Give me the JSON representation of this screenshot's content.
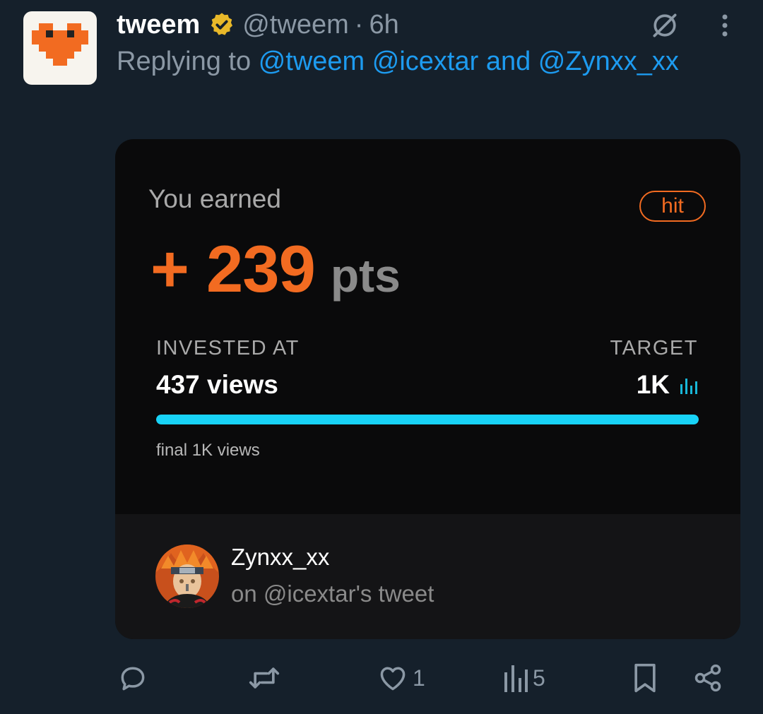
{
  "tweet": {
    "display_name": "tweem",
    "handle": "@tweem",
    "separator": "·",
    "time": "6h",
    "replying_prefix": "Replying to",
    "replying_mentions": [
      "@tweem",
      "@icextar"
    ],
    "replying_and": "and",
    "replying_last": "@Zynxx_xx"
  },
  "icons": {
    "avatar": "pixel-heart-logo",
    "verified": "verified-badge-icon",
    "grok": "grok-icon",
    "more": "more-vertical-icon"
  },
  "card": {
    "earned_label": "You earned",
    "badge": "hit",
    "points_value": "+ 239",
    "points_unit": "pts",
    "invested_label": "INVESTED AT",
    "invested_value": "437 views",
    "target_label": "TARGET",
    "target_value": "1K",
    "progress_fraction": 1.0,
    "final_label": "final 1K views",
    "user_name": "Zynxx_xx",
    "user_sub": "on @icextar's tweet"
  },
  "actions": {
    "reply_count": "",
    "retweet_count": "",
    "like_count": "1",
    "views_count": "5"
  },
  "colors": {
    "background": "#15202b",
    "accent_orange": "#f26b21",
    "progress_cyan": "#18d3f7",
    "link_blue": "#1d9bf0",
    "verified_gold": "#e8b829"
  }
}
